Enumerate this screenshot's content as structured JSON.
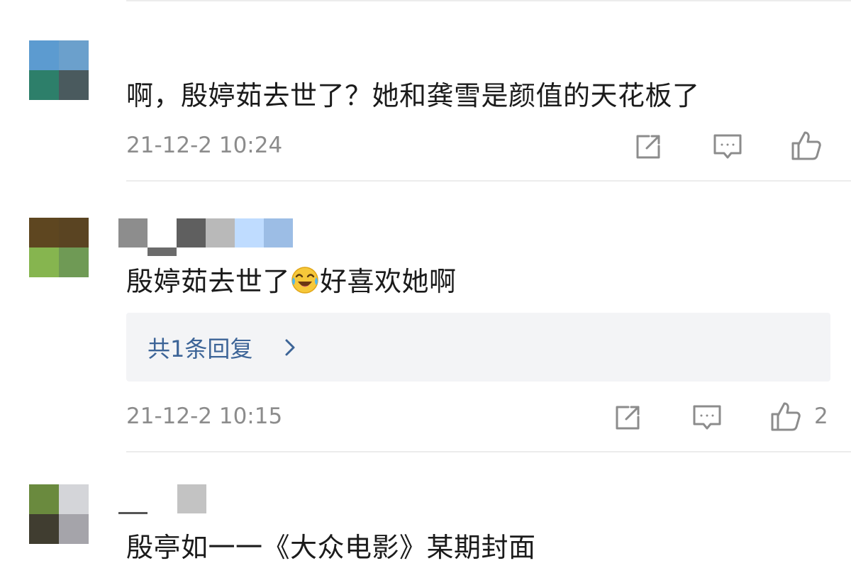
{
  "comments": [
    {
      "text": "啊，殷婷茹去世了？她和龚雪是颜值的天花板了",
      "timestamp": "21-12-2 10:24",
      "likes": "",
      "avatar_colors": [
        "#5c9bd0",
        "#6ba0cc",
        "#2d7f6a",
        "#4a5a5e"
      ]
    },
    {
      "text_before_emoji": "殷婷茹去世了",
      "emoji": "laughing-crying-emoji",
      "text_after_emoji": "好喜欢她啊",
      "timestamp": "21-12-2 10:15",
      "likes": "2",
      "reply_link": "共1条回复",
      "avatar_colors": [
        "#5e4620",
        "#5a4422",
        "#86b54f",
        "#6f9a55"
      ],
      "username_mosaic_colors": [
        "#8d8d8d",
        "#ffffff",
        "#5f5f5f",
        "#b9b9b9",
        "#bfdcff",
        "#9cbde5"
      ]
    },
    {
      "text": "殷亭如一一《大众电影》某期封面",
      "avatar_colors": [
        "#6a8a3e",
        "#d4d5d9",
        "#403d30",
        "#a5a4aa"
      ],
      "username_mosaic_colors": [
        "#c3c3c3"
      ]
    }
  ],
  "icons": {
    "share": "share-icon",
    "comment": "comment-icon",
    "like": "thumbs-up-icon",
    "reply_arrow": "chevron-right-icon"
  },
  "colors": {
    "text": "#1b1b1b",
    "meta": "#8c8c8c",
    "link": "#3c6497",
    "reply_bg": "#f3f4f6",
    "divider": "#ececec"
  }
}
